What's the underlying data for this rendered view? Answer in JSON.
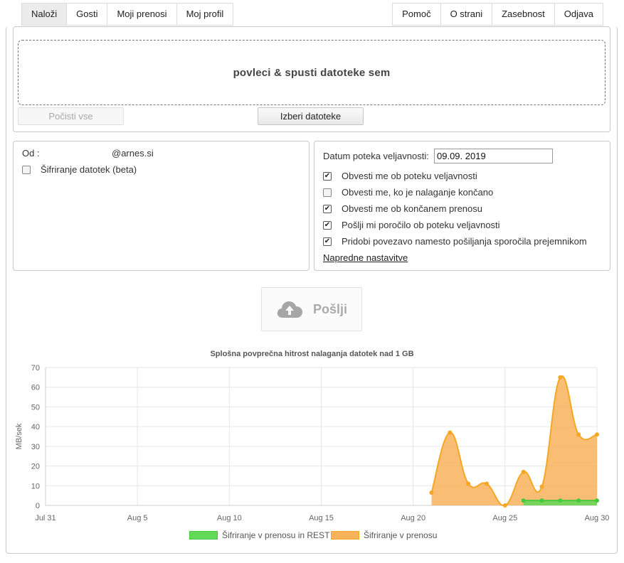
{
  "nav": {
    "left": [
      "Naloži",
      "Gosti",
      "Moji prenosi",
      "Moj profil"
    ],
    "right": [
      "Pomoč",
      "O strani",
      "Zasebnost",
      "Odjava"
    ],
    "active": "Naloži"
  },
  "upload": {
    "dropzone_text": "povleci & spusti datoteke sem",
    "clear_label": "Počisti vse",
    "choose_label": "Izberi datoteke"
  },
  "sender": {
    "from_label": "Od :",
    "email": "@arnes.si",
    "encrypt_label": "Šifriranje datotek (beta)",
    "encrypt_checked": false
  },
  "options": {
    "expiry_label": "Datum poteka veljavnosti:",
    "expiry_value": "09.09. 2019",
    "checkboxes": [
      {
        "label": "Obvesti me ob poteku veljavnosti",
        "checked": true
      },
      {
        "label": "Obvesti me, ko je nalaganje končano",
        "checked": false
      },
      {
        "label": "Obvesti me ob končanem prenosu",
        "checked": true
      },
      {
        "label": "Pošlji mi poročilo ob poteku veljavnosti",
        "checked": true
      },
      {
        "label": "Pridobi povezavo namesto pošiljanja sporočila prejemnikom",
        "checked": true
      }
    ],
    "advanced_link": "Napredne nastavitve"
  },
  "send": {
    "label": "Pošlji",
    "icon": "cloud-upload-icon"
  },
  "chart_data": {
    "type": "area",
    "title": "Splošna povprečna hitrost nalaganja datotek nad 1 GB",
    "ylabel": "MB/sek",
    "xlabel": "",
    "ylim": [
      0,
      70
    ],
    "yticks": [
      0,
      10,
      20,
      30,
      40,
      50,
      60,
      70
    ],
    "x_range": [
      0,
      30
    ],
    "xticks": [
      {
        "day": 0,
        "label": "Jul 31"
      },
      {
        "day": 5,
        "label": "Aug 5"
      },
      {
        "day": 10,
        "label": "Aug 10"
      },
      {
        "day": 15,
        "label": "Aug 15"
      },
      {
        "day": 20,
        "label": "Aug 20"
      },
      {
        "day": 25,
        "label": "Aug 25"
      },
      {
        "day": 30,
        "label": "Aug 30"
      }
    ],
    "grid": true,
    "legend_position": "bottom",
    "series": [
      {
        "name": "Šifriranje v prenosu",
        "color": "#f5a623",
        "fill": "#f8b35a",
        "points": [
          [
            21,
            6.5
          ],
          [
            22,
            37
          ],
          [
            23,
            11
          ],
          [
            24,
            11
          ],
          [
            25,
            0
          ],
          [
            26,
            17
          ],
          [
            27,
            9.5
          ],
          [
            28,
            65
          ],
          [
            29,
            36
          ],
          [
            30,
            36
          ]
        ]
      },
      {
        "name": "Šifriranje v prenosu in REST",
        "color": "#48c83c",
        "fill": "#62d957",
        "points": [
          [
            26,
            2.5
          ],
          [
            27,
            2.5
          ],
          [
            28,
            2.5
          ],
          [
            29,
            2.5
          ],
          [
            30,
            2.5
          ]
        ]
      }
    ]
  }
}
